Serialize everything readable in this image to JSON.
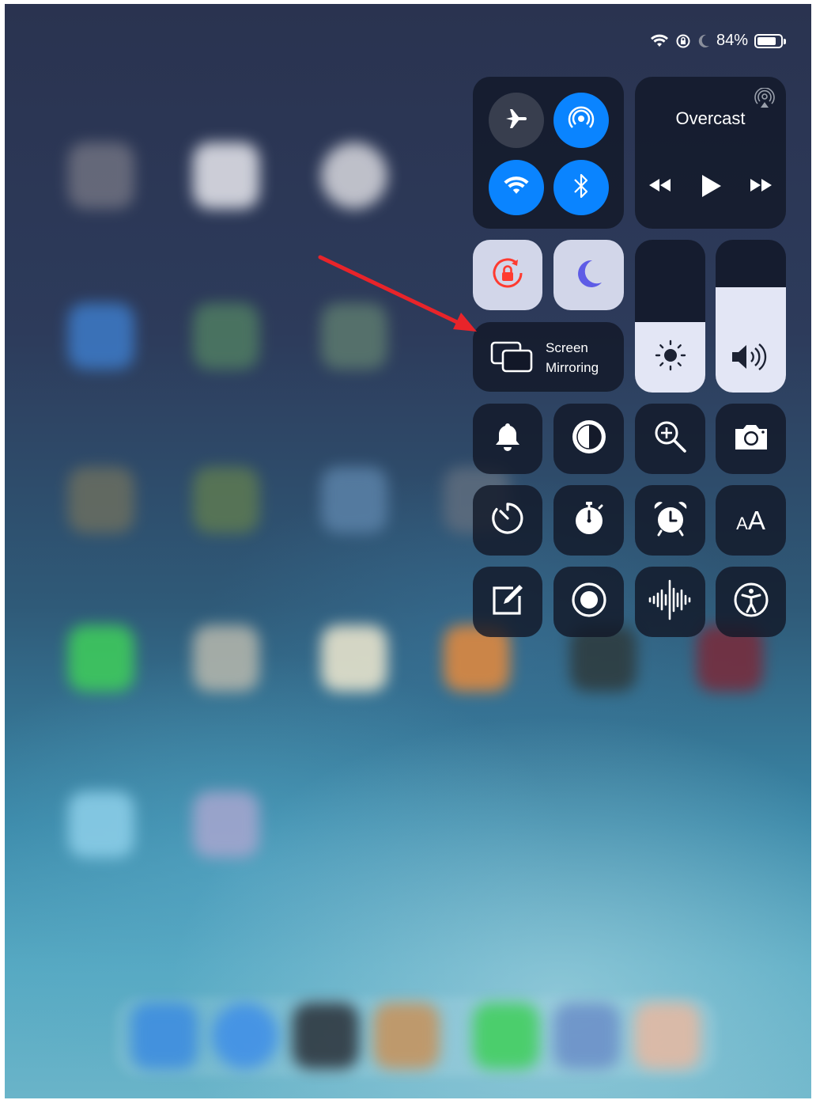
{
  "status_bar": {
    "battery_percent_text": "84%",
    "battery_level": 0.84,
    "icons": [
      "wifi-icon",
      "orientation-lock-icon",
      "moon-icon",
      "battery-icon"
    ]
  },
  "connectivity": {
    "airplane_mode": false,
    "airdrop": true,
    "wifi": true,
    "bluetooth": true
  },
  "now_playing": {
    "title": "Overcast",
    "controls": [
      "rewind-icon",
      "play-icon",
      "fast-forward-icon"
    ],
    "airplay_icon": "airplay-audio-icon"
  },
  "toggles": {
    "orientation_lock": true,
    "do_not_disturb": true
  },
  "screen_mirroring": {
    "line1": "Screen",
    "line2": "Mirroring"
  },
  "sliders": {
    "brightness_level": 0.46,
    "volume_level": 0.69
  },
  "shortcuts": [
    "bell-icon",
    "dark-mode-icon",
    "magnifier-icon",
    "camera-icon",
    "timer-icon",
    "stopwatch-icon",
    "alarm-icon",
    "text-size-icon",
    "notes-icon",
    "screen-record-icon",
    "voice-memos-icon",
    "accessibility-icon"
  ],
  "text_size_label": "AA",
  "colors": {
    "accent_blue": "#0a84ff",
    "orientation_lock_red": "#ff3b30",
    "dnd_purple": "#5e5ce6",
    "annotation_arrow": "#e8242a"
  }
}
